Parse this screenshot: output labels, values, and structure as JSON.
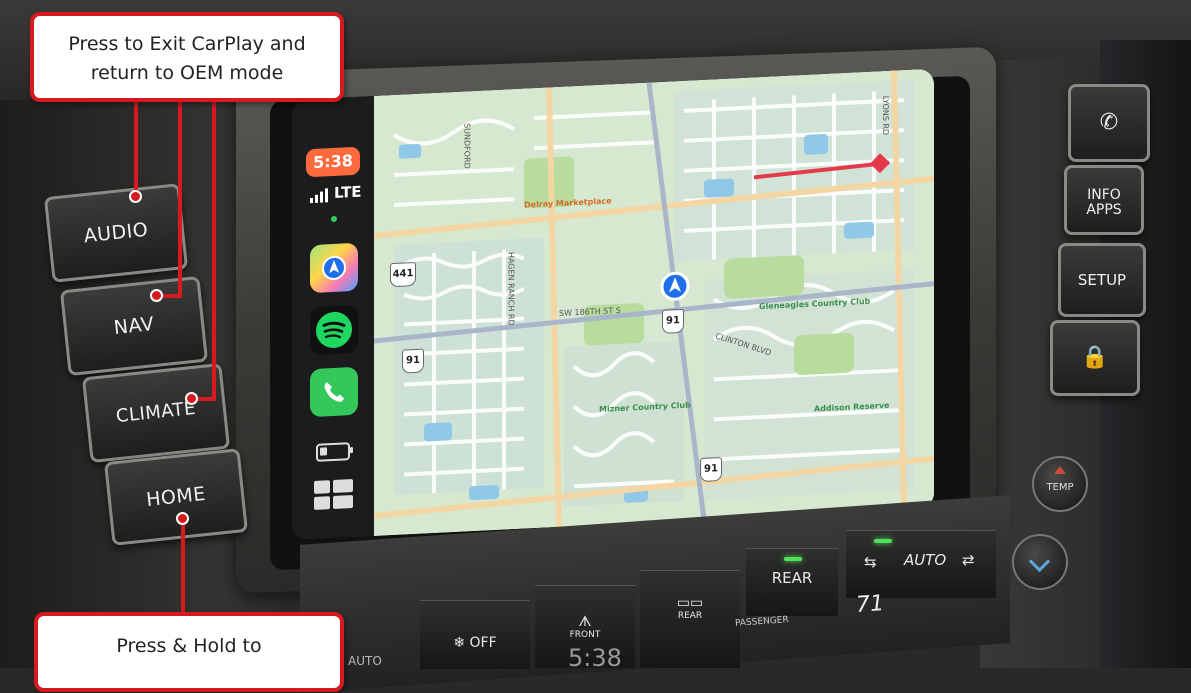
{
  "callouts": {
    "exit_carplay_line1": "Press to Exit CarPlay and",
    "exit_carplay_line2": "return to OEM mode",
    "home_line1": "Press & Hold to"
  },
  "carplay": {
    "status": {
      "time": "5:38",
      "network": "LTE"
    },
    "dock": [
      "maps-icon",
      "spotify-icon",
      "phone-icon"
    ],
    "map": {
      "places": [
        "Delray Marketplace",
        "Gleneagles Country Club",
        "Mizner Country Club",
        "Addison Reserve"
      ],
      "roads": [
        "SW 186TH ST S",
        "HAGEN RANCH RD",
        "CLINTON BLVD",
        "LYONS RD",
        "SUNDFORD"
      ],
      "route_shields": [
        "441",
        "91",
        "91",
        "91"
      ]
    }
  },
  "left_buttons": {
    "audio": "AUDIO",
    "nav": "NAV",
    "climate": "CLIMATE",
    "home": "HOME"
  },
  "right_buttons": {
    "phone": "✆",
    "info_line1": "INFO",
    "info_line2": "APPS",
    "setup": "SETUP",
    "lock": "🔒",
    "temp": "TEMP"
  },
  "climate_panel": {
    "fan_off": "❄ OFF",
    "front": "FRONT",
    "rear_defrost": "REAR",
    "rear": "REAR",
    "auto": "AUTO",
    "passenger": "PASSENGER",
    "temperature": "71",
    "auto_partial": "AUTO",
    "clock_partial": "5:38"
  },
  "colors": {
    "callout_border": "#d71920",
    "time_pill": "#ff6a3d",
    "indicator": "#52e05a",
    "route": "#e5394b"
  }
}
